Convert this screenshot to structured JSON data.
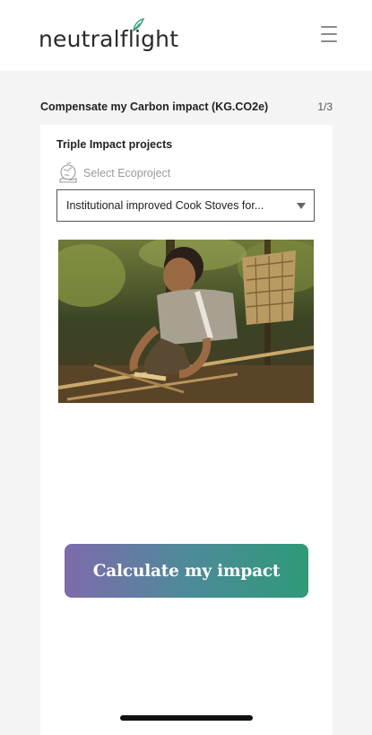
{
  "header": {
    "logo_text": "neutralflight",
    "menu_icon": "hamburger-menu-icon"
  },
  "section": {
    "title": "Compensate my Carbon impact (KG.CO2e)",
    "step": "1/3"
  },
  "card": {
    "label": "Triple Impact projects",
    "eco_icon": "globe-hand-icon",
    "eco_prompt": "Select Ecoproject",
    "select_value": "Institutional improved Cook Stoves for...",
    "image_alt": "Man in forest carving bamboo with a woven basket on his back",
    "cta_label": "Calculate my impact"
  },
  "colors": {
    "cta_gradient_start": "#7e6aab",
    "cta_gradient_end": "#2e9a78",
    "logo_accent": "#2e9a78"
  }
}
